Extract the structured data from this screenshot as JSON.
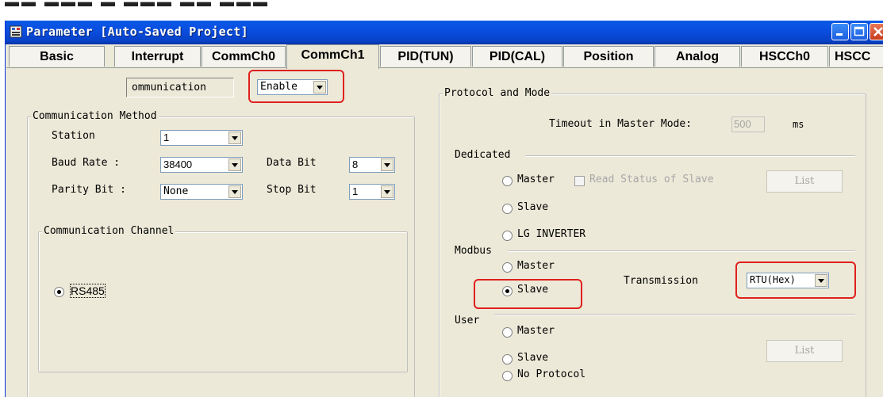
{
  "window": {
    "title": "Parameter [Auto-Saved Project]"
  },
  "tabs": [
    {
      "label": "Basic"
    },
    {
      "label": "Interrupt"
    },
    {
      "label": "CommCh0"
    },
    {
      "label": "CommCh1"
    },
    {
      "label": "PID(TUN)"
    },
    {
      "label": "PID(CAL)"
    },
    {
      "label": "Position"
    },
    {
      "label": "Analog"
    },
    {
      "label": "HSCCh0"
    },
    {
      "label": "HSCC"
    }
  ],
  "active_tab": "CommCh1",
  "communication": {
    "label": "ommunication",
    "value": "Enable"
  },
  "comm_method": {
    "title": "Communication Method",
    "station_label": "Station",
    "station_value": "1",
    "baud_label": "Baud Rate :",
    "baud_value": "38400",
    "databit_label": "Data Bit",
    "databit_value": "8",
    "parity_label": "Parity Bit :",
    "parity_value": "None",
    "stopbit_label": "Stop Bit",
    "stopbit_value": "1"
  },
  "comm_channel": {
    "title": "Communication Channel",
    "option": "RS485"
  },
  "protocol": {
    "title": "Protocol and Mode",
    "timeout_label": "Timeout in Master Mode:",
    "timeout_value": "500",
    "timeout_unit": "ms",
    "dedicated": {
      "title": "Dedicated",
      "master": "Master",
      "read_status": "Read Status of Slave",
      "list": "List",
      "slave": "Slave",
      "lg_inverter": "LG INVERTER"
    },
    "modbus": {
      "title": "Modbus",
      "master": "Master",
      "slave": "Slave",
      "transmission_label": "Transmission",
      "transmission_value": "RTU(Hex)"
    },
    "user": {
      "title": "User",
      "master": "Master",
      "slave": "Slave",
      "no_protocol": "No Protocol",
      "list": "List"
    }
  },
  "colors": {
    "titlebar": "#0a50e0",
    "face": "#ece9d8",
    "highlight": "#e0201e"
  }
}
